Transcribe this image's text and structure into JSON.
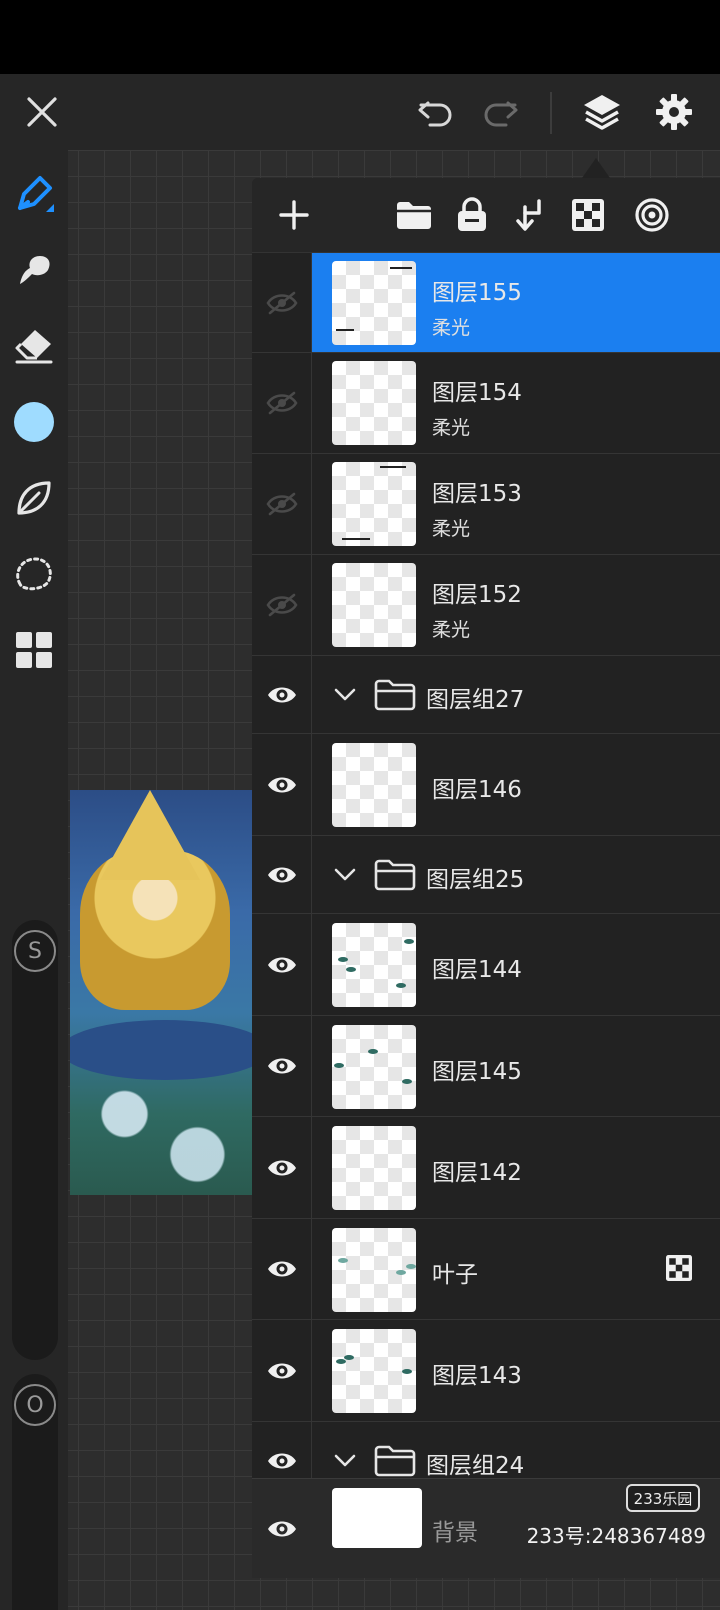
{
  "top_bar": {
    "close_icon": "close-icon",
    "undo_icon": "undo-icon",
    "redo_icon": "redo-icon",
    "layers_icon": "layers-icon",
    "settings_icon": "gear-icon"
  },
  "tools": {
    "items": [
      "pen-icon",
      "smudge-icon",
      "eraser-icon",
      "color-swatch",
      "leaf-icon",
      "lasso-icon",
      "grid-icon"
    ],
    "active_color": "#9fdcff",
    "size_label": "S",
    "opacity_label": "O"
  },
  "layers_panel": {
    "toolbar_icons": [
      "add-layer-icon",
      "folder-icon",
      "lock-icon",
      "merge-down-icon",
      "transparency-icon",
      "target-icon"
    ],
    "rows": [
      {
        "type": "layer",
        "name": "图层155",
        "blend": "柔光",
        "visible": false,
        "selected": true
      },
      {
        "type": "layer",
        "name": "图层154",
        "blend": "柔光",
        "visible": false,
        "selected": false
      },
      {
        "type": "layer",
        "name": "图层153",
        "blend": "柔光",
        "visible": false,
        "selected": false
      },
      {
        "type": "layer",
        "name": "图层152",
        "blend": "柔光",
        "visible": false,
        "selected": false
      },
      {
        "type": "group",
        "name": "图层组27",
        "visible": true
      },
      {
        "type": "layer",
        "name": "图层146",
        "visible": true
      },
      {
        "type": "group",
        "name": "图层组25",
        "visible": true
      },
      {
        "type": "layer",
        "name": "图层144",
        "visible": true
      },
      {
        "type": "layer",
        "name": "图层145",
        "visible": true
      },
      {
        "type": "layer",
        "name": "图层142",
        "visible": true
      },
      {
        "type": "layer",
        "name": "叶子",
        "visible": true,
        "badge": "alpha-lock-icon"
      },
      {
        "type": "layer",
        "name": "图层143",
        "visible": true
      },
      {
        "type": "group",
        "name": "图层组24",
        "visible": true
      }
    ],
    "background": {
      "name": "背景",
      "visible": true
    }
  },
  "watermark": {
    "logo": "233乐园",
    "text": "233号:248367489"
  },
  "colors": {
    "selected_row": "#1b7ff0",
    "accent_tool": "#1e90ff"
  }
}
